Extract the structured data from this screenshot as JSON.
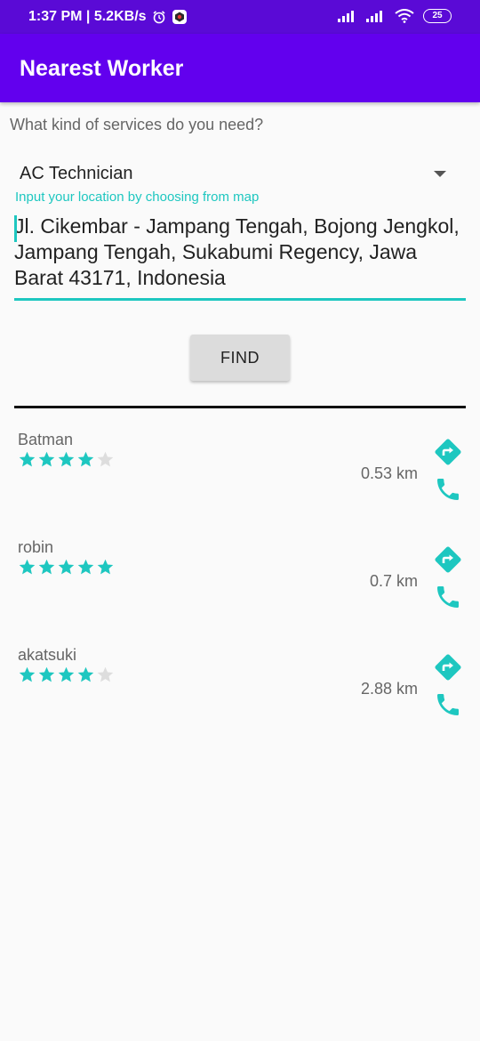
{
  "status_bar": {
    "time_speed": "1:37 PM | 5.2KB/s",
    "battery": "25"
  },
  "app_bar": {
    "title": "Nearest Worker"
  },
  "form": {
    "question": "What kind of services do you need?",
    "service_selected": "AC Technician",
    "location_hint": "Input your location by choosing from map",
    "location_value": "Jl. Cikembar - Jampang Tengah, Bojong Jengkol, Jampang Tengah, Sukabumi Regency, Jawa Barat 43171, Indonesia",
    "find_label": "FIND"
  },
  "workers": [
    {
      "name": "Batman",
      "rating": 4,
      "max_rating": 5,
      "distance": "0.53 km"
    },
    {
      "name": "robin",
      "rating": 5,
      "max_rating": 5,
      "distance": "0.7 km"
    },
    {
      "name": "akatsuki",
      "rating": 4,
      "max_rating": 5,
      "distance": "2.88 km"
    }
  ],
  "colors": {
    "status_bar": "#5a0ad6",
    "app_bar": "#6200ee",
    "accent": "#1ec7c0",
    "star_empty": "#dddddd"
  },
  "icons": {
    "directions": "directions-icon",
    "call": "phone-icon",
    "dropdown": "chevron-down-icon"
  }
}
